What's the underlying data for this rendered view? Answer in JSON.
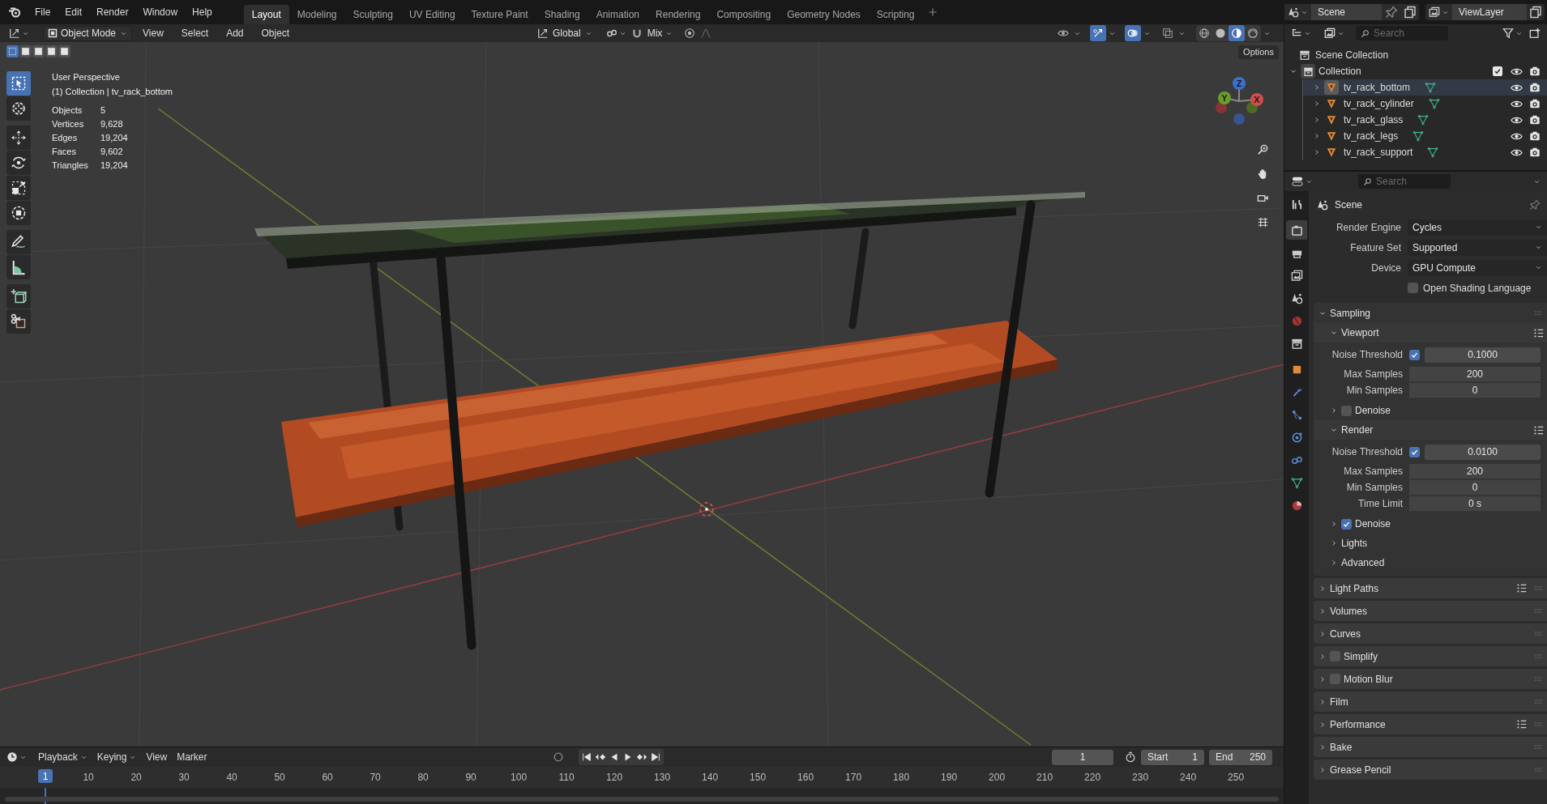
{
  "top_bar": {
    "menus": [
      "File",
      "Edit",
      "Render",
      "Window",
      "Help"
    ],
    "workspaces": [
      {
        "label": "Layout",
        "selected": true
      },
      {
        "label": "Modeling",
        "selected": false
      },
      {
        "label": "Sculpting",
        "selected": false
      },
      {
        "label": "UV Editing",
        "selected": false
      },
      {
        "label": "Texture Paint",
        "selected": false
      },
      {
        "label": "Shading",
        "selected": false
      },
      {
        "label": "Animation",
        "selected": false
      },
      {
        "label": "Rendering",
        "selected": false
      },
      {
        "label": "Compositing",
        "selected": false
      },
      {
        "label": "Geometry Nodes",
        "selected": false
      },
      {
        "label": "Scripting",
        "selected": false
      }
    ],
    "scene": "Scene",
    "view_layer": "ViewLayer"
  },
  "viewport": {
    "header": {
      "mode": "Object Mode",
      "menus": [
        "View",
        "Select",
        "Add",
        "Object"
      ],
      "orientation": "Global",
      "snap_target": "Mix",
      "toggles": [
        {
          "kind": "visibility",
          "on": false
        },
        {
          "kind": "gizmo",
          "on": true
        },
        {
          "kind": "overlay",
          "on": true
        },
        {
          "kind": "xray",
          "on": false
        }
      ],
      "shading": [
        {
          "kind": "wireframe",
          "selected": false
        },
        {
          "kind": "solid",
          "selected": false
        },
        {
          "kind": "material",
          "selected": true
        },
        {
          "kind": "rendered",
          "selected": false
        }
      ]
    },
    "select_modes": [
      {
        "selected": true
      },
      {
        "selected": false
      },
      {
        "selected": false
      },
      {
        "selected": false
      },
      {
        "selected": false
      }
    ],
    "options": "Options",
    "tools": [
      {
        "kind": "select_box",
        "selected": true
      },
      {
        "kind": "cursor",
        "selected": false
      },
      {
        "kind": "move",
        "selected": false
      },
      {
        "kind": "rotate",
        "selected": false
      },
      {
        "kind": "scale",
        "selected": false
      },
      {
        "kind": "transform",
        "selected": false
      },
      {
        "kind": "annotate",
        "selected": false
      },
      {
        "kind": "measure",
        "selected": false
      },
      {
        "kind": "add_cube",
        "selected": false
      },
      {
        "kind": "cut",
        "selected": false
      }
    ],
    "view_name": "User Perspective",
    "context": "(1) Collection | tv_rack_bottom",
    "stats": [
      {
        "label": "Objects",
        "value": "5"
      },
      {
        "label": "Vertices",
        "value": "9,628"
      },
      {
        "label": "Edges",
        "value": "19,204"
      },
      {
        "label": "Faces",
        "value": "9,602"
      },
      {
        "label": "Triangles",
        "value": "19,204"
      }
    ],
    "axis_gizmo": [
      {
        "kind": "z",
        "label": "Z"
      },
      {
        "kind": "y",
        "label": "Y"
      },
      {
        "kind": "x",
        "label": "X"
      }
    ],
    "nav_buttons": [
      {
        "kind": "zoom"
      },
      {
        "kind": "pan"
      },
      {
        "kind": "camera"
      },
      {
        "kind": "ortho"
      }
    ]
  },
  "outliner": {
    "search_placeholder": "Search",
    "root": "Scene Collection",
    "collection": {
      "label": "Collection",
      "expanded": true,
      "checked": true,
      "children": [
        {
          "label": "tv_rack_bottom",
          "selected": true
        },
        {
          "label": "tv_rack_cylinder",
          "selected": false
        },
        {
          "label": "tv_rack_glass",
          "selected": false
        },
        {
          "label": "tv_rack_legs",
          "selected": false
        },
        {
          "label": "tv_rack_support",
          "selected": false
        }
      ]
    }
  },
  "properties": {
    "search_placeholder": "Search",
    "context": "Scene",
    "tabs": [
      {
        "kind": "tool",
        "selected": false
      },
      {
        "kind": "render",
        "selected": true
      },
      {
        "kind": "output",
        "selected": false
      },
      {
        "kind": "view_layer",
        "selected": false
      },
      {
        "kind": "scene",
        "selected": false
      },
      {
        "kind": "world",
        "selected": false
      },
      {
        "kind": "collection",
        "selected": false
      },
      {
        "kind": "object",
        "selected": false
      },
      {
        "kind": "modifiers",
        "selected": false
      },
      {
        "kind": "particles",
        "selected": false
      },
      {
        "kind": "physics",
        "selected": false
      },
      {
        "kind": "constraints",
        "selected": false
      },
      {
        "kind": "data",
        "selected": false
      },
      {
        "kind": "material",
        "selected": false
      }
    ],
    "settings": [
      {
        "kind": "dropdown",
        "label": "Render Engine",
        "value": "Cycles"
      },
      {
        "kind": "dropdown",
        "label": "Feature Set",
        "value": "Supported"
      },
      {
        "kind": "dropdown",
        "label": "Device",
        "value": "GPU Compute"
      },
      {
        "kind": "checkbox",
        "label": "Open Shading Language",
        "checked": false
      }
    ],
    "panels": [
      {
        "label": "Sampling",
        "expanded": true,
        "children": [
          {
            "label": "Viewport",
            "expanded": true,
            "presets": true,
            "rows": [
              {
                "kind": "toggle_number",
                "label": "Noise Threshold",
                "checked": true,
                "value": "0.1000"
              },
              {
                "kind": "number",
                "label": "Max Samples",
                "value": "200"
              },
              {
                "kind": "number",
                "label": "Min Samples",
                "value": "0"
              }
            ]
          },
          {
            "label": "Denoise",
            "expanded": false,
            "checked": false
          },
          {
            "label": "Render",
            "expanded": true,
            "presets": true,
            "rows": [
              {
                "kind": "toggle_number",
                "label": "Noise Threshold",
                "checked": true,
                "value": "0.0100"
              },
              {
                "kind": "number",
                "label": "Max Samples",
                "value": "200"
              },
              {
                "kind": "number",
                "label": "Min Samples",
                "value": "0"
              },
              {
                "kind": "number",
                "label": "Time Limit",
                "value": "0 s"
              }
            ]
          },
          {
            "label": "Denoise",
            "expanded": false,
            "checked": true
          },
          {
            "label": "Lights",
            "expanded": false
          },
          {
            "label": "Advanced",
            "expanded": false
          }
        ]
      },
      {
        "label": "Light Paths",
        "expanded": false,
        "presets": true
      },
      {
        "label": "Volumes",
        "expanded": false
      },
      {
        "label": "Curves",
        "expanded": false
      },
      {
        "label": "Simplify",
        "expanded": false,
        "checked": false
      },
      {
        "label": "Motion Blur",
        "expanded": false,
        "checked": false
      },
      {
        "label": "Film",
        "expanded": false
      },
      {
        "label": "Performance",
        "expanded": false,
        "presets": true
      },
      {
        "label": "Bake",
        "expanded": false
      },
      {
        "label": "Grease Pencil",
        "expanded": false
      }
    ]
  },
  "timeline": {
    "menus": [
      "Playback",
      "Keying",
      "View",
      "Marker"
    ],
    "current_frame": "1",
    "start_label": "Start",
    "start": "1",
    "end_label": "End",
    "end": "250",
    "playhead": "1",
    "ticks": [
      "10",
      "20",
      "30",
      "40",
      "50",
      "60",
      "70",
      "80",
      "90",
      "100",
      "110",
      "120",
      "130",
      "140",
      "150",
      "160",
      "170",
      "180",
      "190",
      "200",
      "210",
      "220",
      "230",
      "240",
      "250"
    ]
  }
}
